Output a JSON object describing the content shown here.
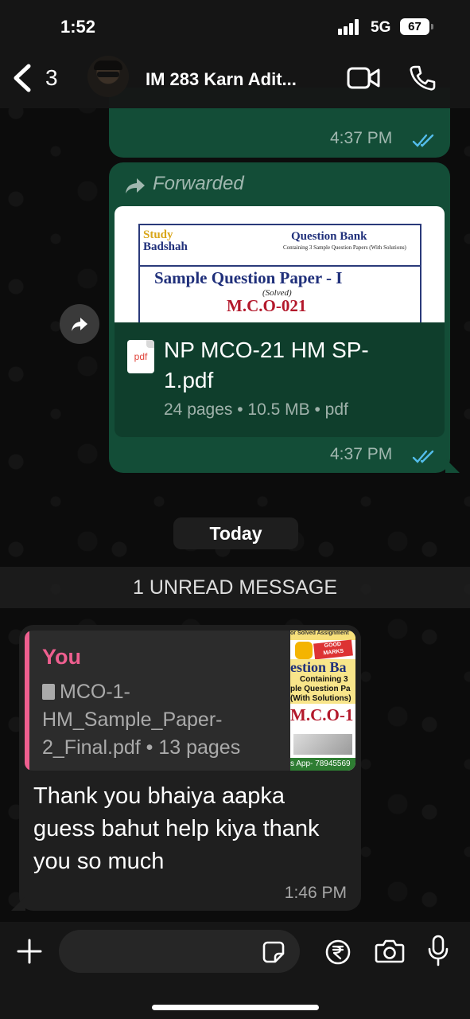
{
  "status_bar": {
    "time": "1:52",
    "network": "5G",
    "battery": "67"
  },
  "header": {
    "back_count": "3",
    "contact_name": "IM 283 Karn Adit..."
  },
  "messages": {
    "first_time": "4:37 PM",
    "forwarded": {
      "label": "Forwarded",
      "preview": {
        "brand_top": "Study",
        "brand_bottom": "Badshah",
        "heading": "Question Bank",
        "subheading": "Containing 3 Sample Question Papers (With Solutions)",
        "title": "Sample Question Paper - I",
        "solved": "(Solved)",
        "code": "M.C.O-021"
      },
      "file_type_icon": "pdf",
      "file_name": "NP MCO-21 HM SP-1.pdf",
      "file_meta": "24 pages • 10.5 MB • pdf",
      "time": "4:37 PM"
    },
    "date_chip": "Today",
    "unread_banner": "1 UNREAD MESSAGE",
    "incoming": {
      "quote_author": "You",
      "quote_file": "MCO-1-HM_Sample_Paper-2_Final.pdf • 13 pages",
      "thumb": {
        "top": "or Solved Assignment",
        "marks": "GOOD MARKS",
        "heading": "estion Ba",
        "containing": "Containing 3",
        "line1": "ple Question Pa",
        "line2": "(With Solutions)",
        "code": "M.C.O-1",
        "app": "s App- 78945569"
      },
      "text": "Thank you bhaiya aapka guess  bahut help kiya thank you so much",
      "time": "1:46 PM"
    }
  },
  "colors": {
    "outgoing_bubble": "#134d37",
    "incoming_bubble": "#1f1f1f",
    "read_ticks": "#53bdeb",
    "quote_accent": "#ee5f8f"
  },
  "icons": [
    "back-chevron-icon",
    "video-call-icon",
    "phone-icon",
    "forward-arrow-icon",
    "share-icon",
    "pdf-icon",
    "read-ticks-icon",
    "plus-icon",
    "sticker-icon",
    "rupee-icon",
    "camera-icon",
    "mic-icon"
  ]
}
